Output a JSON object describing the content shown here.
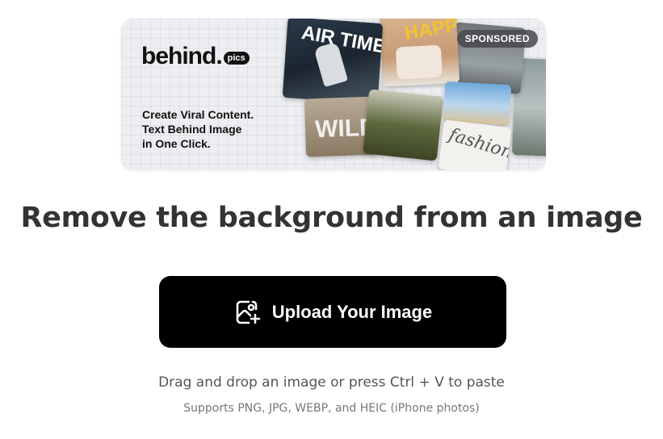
{
  "ad": {
    "brand_name": "behind.",
    "brand_suffix": "pics",
    "tagline": [
      "Create Viral Content.",
      "Text Behind Image",
      "in One Click."
    ],
    "badge": "SPONSORED",
    "tile_texts": {
      "air_time": "AIR TIME",
      "happy": "HAPPY",
      "wild": "WILD",
      "fashion": "fashion"
    }
  },
  "main": {
    "headline": "Remove the background from an image",
    "upload_button_label": "Upload Your Image",
    "upload_icon": "image-plus-icon",
    "hint_primary": "Drag and drop an image or press Ctrl + V to paste",
    "hint_secondary": "Supports PNG, JPG, WEBP, and HEIC (iPhone photos)"
  }
}
